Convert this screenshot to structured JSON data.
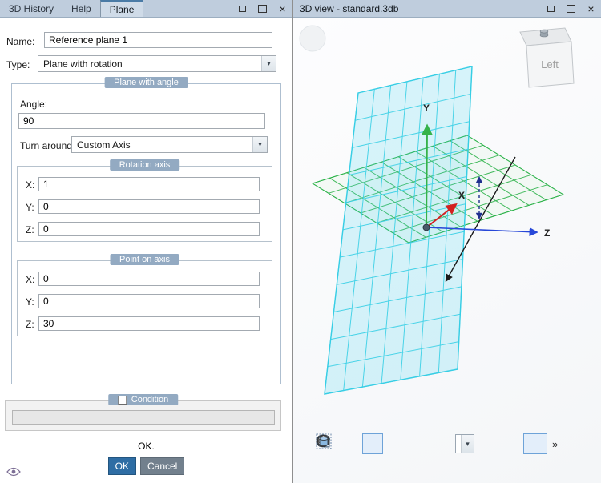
{
  "icons": {
    "chevron_down": "▾",
    "close": "×",
    "overflow": "»"
  },
  "titlebar": {
    "tabs": [
      {
        "label": "3D History"
      },
      {
        "label": "Help"
      },
      {
        "label": "Plane"
      }
    ],
    "right_title": "3D view - standard.3db"
  },
  "form": {
    "name_label": "Name:",
    "name_value": "Reference plane 1",
    "type_label": "Type:",
    "type_value": "Plane with rotation",
    "plane_with_angle": {
      "title": "Plane with angle",
      "angle_label": "Angle:",
      "angle_value": "90",
      "turn_around_label": "Turn around",
      "turn_around_value": "Custom Axis",
      "rotation_axis": {
        "title": "Rotation axis",
        "rows": [
          {
            "label": "X:",
            "value": "1"
          },
          {
            "label": "Y:",
            "value": "0"
          },
          {
            "label": "Z:",
            "value": "0"
          }
        ]
      },
      "point_on_axis": {
        "title": "Point on axis",
        "rows": [
          {
            "label": "X:",
            "value": "0"
          },
          {
            "label": "Y:",
            "value": "0"
          },
          {
            "label": "Z:",
            "value": "30"
          }
        ]
      }
    },
    "condition": {
      "title": "Condition",
      "field_value": ""
    },
    "status_text": "OK.",
    "buttons": {
      "ok": "OK",
      "cancel": "Cancel"
    }
  },
  "viewport": {
    "axis_labels": {
      "x": "X",
      "y": "Y",
      "z": "Z"
    },
    "view_cube_label": "Left"
  },
  "colors": {
    "titlebar": "#bfcddd",
    "group_header": "#93aac2",
    "ok_button": "#2e6da4",
    "cancel_button": "#72808d",
    "plane_cyan": "#2fc9e2",
    "plane_green": "#2db34a",
    "axis_x": "#d42020",
    "axis_y": "#35b24a",
    "axis_z": "#2848d8"
  }
}
